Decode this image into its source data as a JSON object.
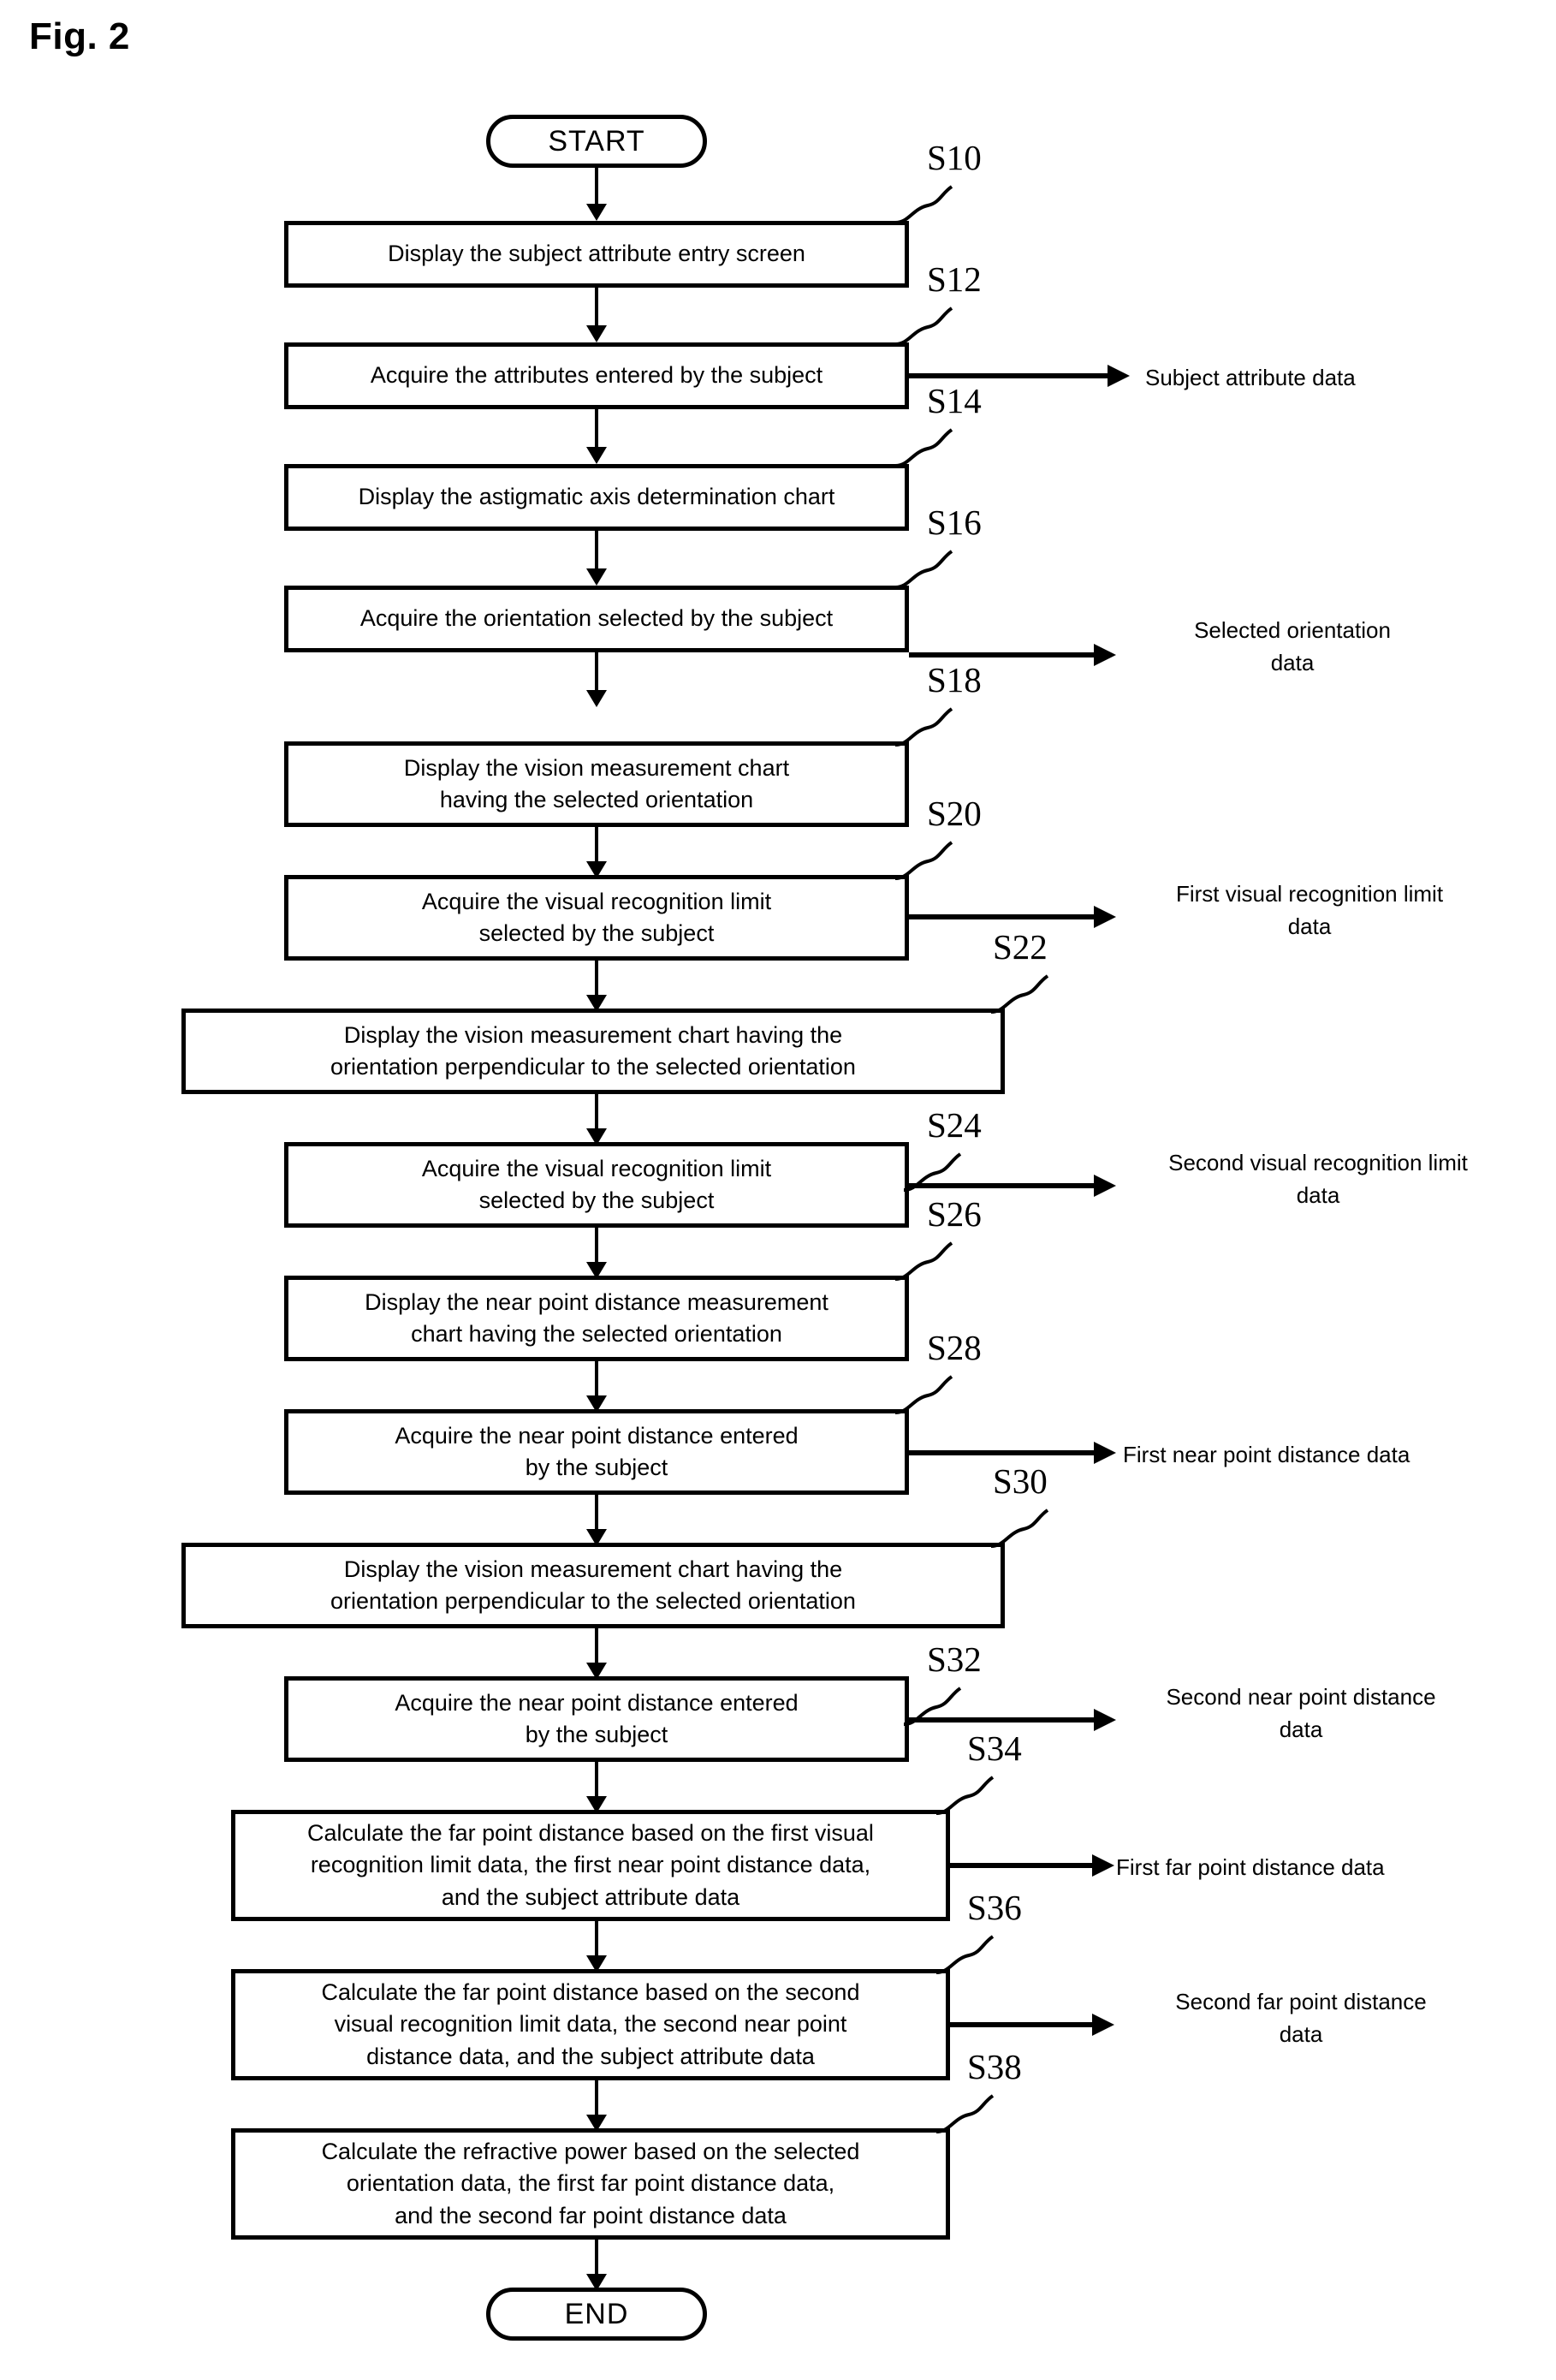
{
  "figure": {
    "caption": "Fig. 2"
  },
  "terminals": {
    "start": "START",
    "end": "END"
  },
  "nodes": [
    {
      "id": "S10",
      "step": "S10",
      "lines": [
        "Display the subject attribute entry screen"
      ]
    },
    {
      "id": "S12",
      "step": "S12",
      "lines": [
        "Acquire the attributes entered by the subject"
      ]
    },
    {
      "id": "S14",
      "step": "S14",
      "lines": [
        "Display the astigmatic axis determination chart"
      ]
    },
    {
      "id": "S16",
      "step": "S16",
      "lines": [
        "Acquire the orientation selected by the subject"
      ]
    },
    {
      "id": "S18",
      "step": "S18",
      "lines": [
        "Display the vision measurement chart",
        "having the selected orientation"
      ]
    },
    {
      "id": "S20",
      "step": "S20",
      "lines": [
        "Acquire the visual recognition limit",
        "selected by the subject"
      ]
    },
    {
      "id": "S22",
      "step": "S22",
      "lines": [
        "Display the vision measurement chart having the",
        "orientation perpendicular to the selected orientation"
      ]
    },
    {
      "id": "S24",
      "step": "S24",
      "lines": [
        "Acquire the visual recognition limit",
        "selected by the subject"
      ]
    },
    {
      "id": "S26",
      "step": "S26",
      "lines": [
        "Display the near point distance measurement",
        "chart having the selected orientation"
      ]
    },
    {
      "id": "S28",
      "step": "S28",
      "lines": [
        "Acquire the near point distance entered",
        "by the subject"
      ]
    },
    {
      "id": "S30",
      "step": "S30",
      "lines": [
        "Display the vision measurement chart having the",
        "orientation perpendicular to the selected orientation"
      ]
    },
    {
      "id": "S32",
      "step": "S32",
      "lines": [
        "Acquire the near point distance entered",
        "by the subject"
      ]
    },
    {
      "id": "S34",
      "step": "S34",
      "lines": [
        "Calculate the far point distance based on the first visual",
        "recognition limit data, the first near point distance data,",
        "and the subject attribute data"
      ]
    },
    {
      "id": "S36",
      "step": "S36",
      "lines": [
        "Calculate the far point distance based on the second",
        "visual recognition limit data, the second near point",
        "distance data, and the subject attribute data"
      ]
    },
    {
      "id": "S38",
      "step": "S38",
      "lines": [
        "Calculate the refractive power based on the selected",
        "orientation data, the first far point distance data,",
        "and the second far point distance data"
      ]
    }
  ],
  "outputs": [
    {
      "id": "out-s12",
      "lines": [
        "Subject attribute data"
      ]
    },
    {
      "id": "out-s16",
      "lines": [
        "Selected orientation",
        "data"
      ]
    },
    {
      "id": "out-s20",
      "lines": [
        "First visual recognition limit",
        "data"
      ]
    },
    {
      "id": "out-s24",
      "lines": [
        "Second visual recognition limit",
        "data"
      ]
    },
    {
      "id": "out-s28",
      "lines": [
        "First near point distance data"
      ]
    },
    {
      "id": "out-s32",
      "lines": [
        "Second near point distance",
        "data"
      ]
    },
    {
      "id": "out-s34",
      "lines": [
        "First far point distance data"
      ]
    },
    {
      "id": "out-s36",
      "lines": [
        "Second far point distance",
        "data"
      ]
    }
  ],
  "colors": {
    "stroke": "#000000",
    "background": "#ffffff"
  }
}
